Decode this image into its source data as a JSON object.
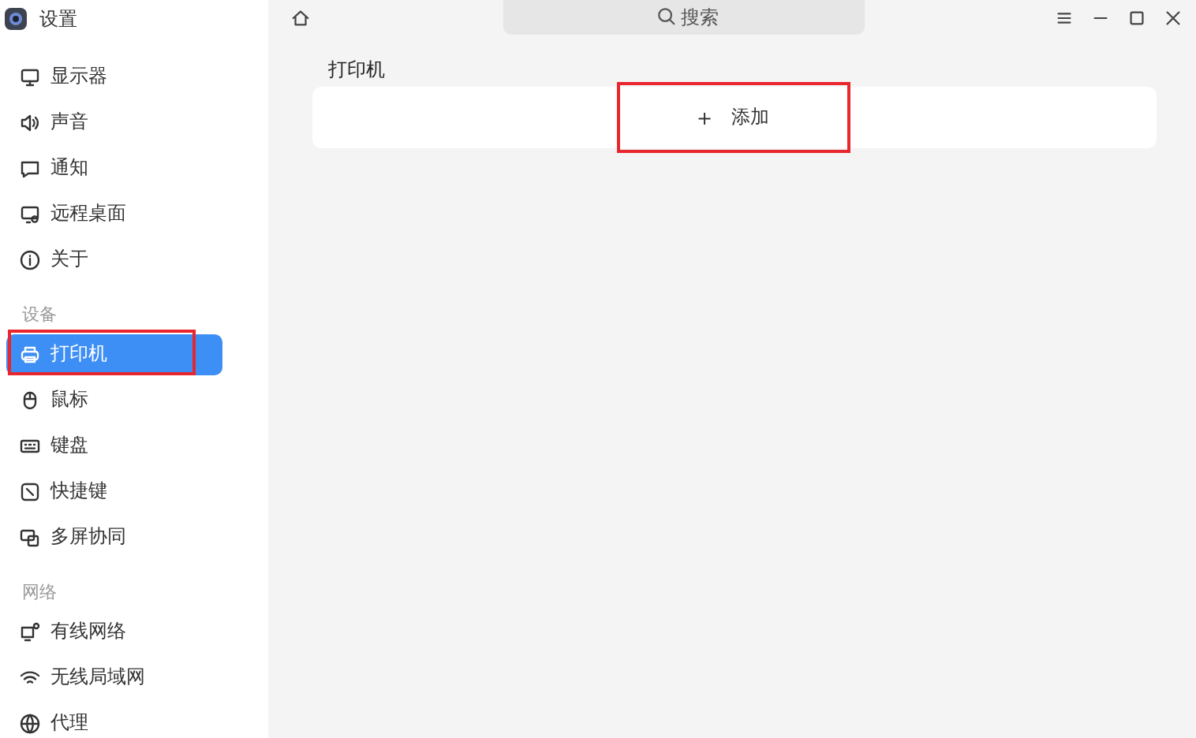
{
  "window": {
    "title": "设置"
  },
  "sidebar": {
    "groups": [
      {
        "items": [
          {
            "label": "显示器",
            "selected": false,
            "annotated": false
          },
          {
            "label": "声音",
            "selected": false,
            "annotated": false
          },
          {
            "label": "通知",
            "selected": false,
            "annotated": false
          },
          {
            "label": "远程桌面",
            "selected": false,
            "annotated": false
          },
          {
            "label": "关于",
            "selected": false,
            "annotated": false
          }
        ]
      },
      {
        "title": "设备",
        "items": [
          {
            "label": "打印机",
            "selected": true,
            "annotated": true
          },
          {
            "label": "鼠标",
            "selected": false,
            "annotated": false
          },
          {
            "label": "键盘",
            "selected": false,
            "annotated": false
          },
          {
            "label": "快捷键",
            "selected": false,
            "annotated": false
          },
          {
            "label": "多屏协同",
            "selected": false,
            "annotated": false
          }
        ]
      },
      {
        "title": "网络",
        "items": [
          {
            "label": "有线网络",
            "selected": false,
            "annotated": false
          },
          {
            "label": "无线局域网",
            "selected": false,
            "annotated": false
          },
          {
            "label": "代理",
            "selected": false,
            "annotated": false
          }
        ]
      }
    ]
  },
  "search": {
    "placeholder": "搜索"
  },
  "main": {
    "heading": "打印机",
    "add_button": {
      "icon_text": "+",
      "label": "添加",
      "annotated": true
    }
  }
}
